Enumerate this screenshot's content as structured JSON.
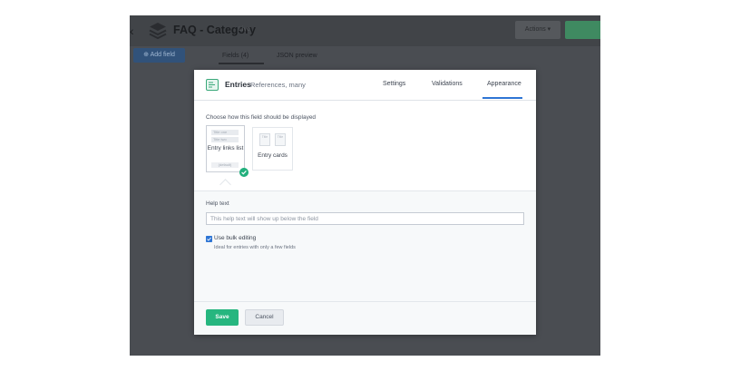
{
  "background_app": {
    "title": "FAQ - Category",
    "title_badge": "Live",
    "actions_label": "Actions ▾",
    "add_field_label": "Add field",
    "tabs": [
      {
        "label": "Fields (4)"
      },
      {
        "label": "JSON preview"
      }
    ]
  },
  "modal": {
    "field_name": "Entries",
    "field_type": "References, many",
    "tabs": [
      {
        "label": "Settings"
      },
      {
        "label": "Validations"
      },
      {
        "label": "Appearance",
        "active": true
      }
    ],
    "appearance": {
      "choose_label": "Choose how this field should be displayed",
      "options": [
        {
          "label": "Entry links list",
          "badge": "(default)",
          "selected": true,
          "thumb_rows": [
            "Title one",
            "Title two"
          ]
        },
        {
          "label": "Entry cards",
          "selected": false,
          "thumb_boxes": [
            "Title",
            "Title"
          ]
        }
      ]
    },
    "help_text": {
      "label": "Help text",
      "placeholder": "This help text will show up below the field"
    },
    "bulk_editing": {
      "label": "Use bulk editing",
      "hint": "Ideal for entries with only a few fields",
      "checked": true
    },
    "footer": {
      "save_label": "Save",
      "cancel_label": "Cancel"
    }
  },
  "colors": {
    "accent": "#2e75d4",
    "success": "#26b67f",
    "overlay": "#4a4d52"
  }
}
